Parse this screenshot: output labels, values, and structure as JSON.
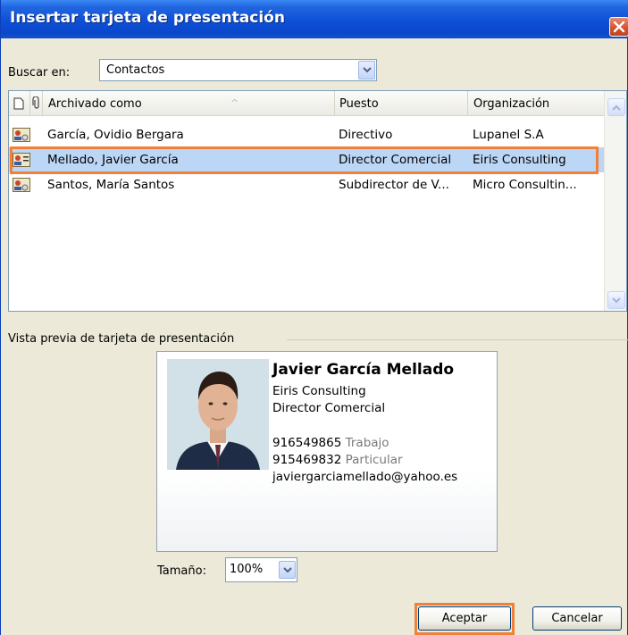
{
  "window": {
    "title": "Insertar tarjeta de presentación"
  },
  "search": {
    "label": "Buscar en:",
    "value": "Contactos"
  },
  "list": {
    "columns": [
      "Archivado como",
      "Puesto",
      "Organización"
    ],
    "sort_arrow": "^",
    "rows": [
      {
        "name": "García, Ovidio Bergara",
        "position": "Directivo",
        "org": "Lupanel S.A"
      },
      {
        "name": "Mellado, Javier García",
        "position": "Director Comercial",
        "org": "Eiris Consulting"
      },
      {
        "name": "Santos, María Santos",
        "position": "Subdirector de V...",
        "org": "Micro Consultin..."
      }
    ]
  },
  "preview": {
    "label": "Vista previa de tarjeta de presentación",
    "card": {
      "name": "Javier García Mellado",
      "company": "Eiris Consulting",
      "title": "Director Comercial",
      "phone_work": "916549865",
      "phone_work_label": "Trabajo",
      "phone_home": "915469832",
      "phone_home_label": "Particular",
      "email": "javiergarciamellado@yahoo.es"
    }
  },
  "size": {
    "label": "Tamaño:",
    "value": "100%"
  },
  "buttons": {
    "accept": "Aceptar",
    "cancel": "Cancelar"
  },
  "colors": {
    "titlebar": "#0d4fd6",
    "selection": "#bcd6f5",
    "highlight": "#f0803a"
  }
}
